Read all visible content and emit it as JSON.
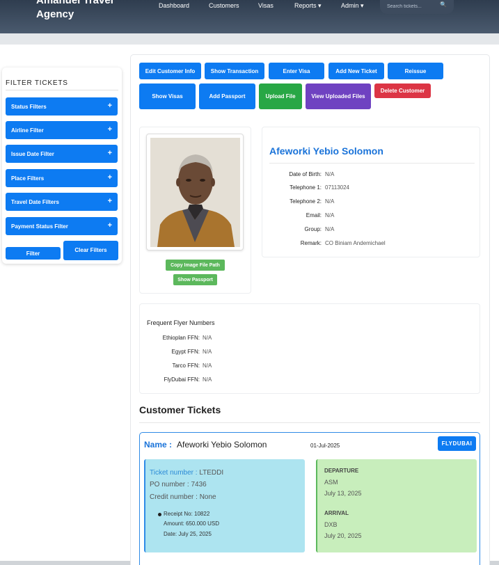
{
  "header": {
    "brand": "Amanuel Travel\nAgency",
    "nav": [
      "Dashboard",
      "Customers",
      "Visas",
      "Reports ▾",
      "Admin ▾"
    ],
    "search_placeholder": "Search tickets..."
  },
  "sidebar": {
    "title": "FILTER TICKETS",
    "filters": [
      "Status Filters",
      "Airline Filter",
      "Issue Date Filter",
      "Place Filters",
      "Travel Date Filters",
      "Payment Status Filter"
    ],
    "filter_button": "Filter",
    "clear_button": "Clear Filters"
  },
  "actions": {
    "edit": "Edit Customer Info",
    "show_transaction": "Show Transaction",
    "enter_visa": "Enter Visa",
    "add_ticket": "Add New Ticket",
    "reissue": "Reissue",
    "show_visas": "Show Visas",
    "add_passport": "Add Passport",
    "upload_file": "Upload File",
    "view_files": "View Uploaded Files",
    "delete_customer": "Delete Customer"
  },
  "photo": {
    "copy_path": "Copy Image File Path",
    "show_passport": "Show Passport"
  },
  "customer": {
    "name": "Afeworki Yebio Solomon",
    "fields": [
      {
        "label": "Date of Birth:",
        "value": "N/A"
      },
      {
        "label": "Telephone 1:",
        "value": "07113024"
      },
      {
        "label": "Telephone 2:",
        "value": "N/A"
      },
      {
        "label": "Email:",
        "value": "N/A"
      },
      {
        "label": "Group:",
        "value": "N/A"
      },
      {
        "label": "Remark:",
        "value": "CO Biniam Andemichael"
      }
    ]
  },
  "ffn": {
    "title": "Frequent Flyer Numbers",
    "rows": [
      {
        "label": "Ethioplan FFN:",
        "value": "N/A"
      },
      {
        "label": "Egypt FFN:",
        "value": "N/A"
      },
      {
        "label": "Tarco FFN:",
        "value": "N/A"
      },
      {
        "label": "FlyDubai FFN:",
        "value": "N/A"
      }
    ]
  },
  "tickets_section": {
    "title": "Customer Tickets"
  },
  "ticket": {
    "name_label": "Name :",
    "name": "Afeworki Yebio Solomon",
    "date": "01-Jul-2025",
    "airline": "FLYDUBAI",
    "ticket_number_label": "Ticket number :",
    "ticket_number": "LTEDDI",
    "po_label": "PO number :",
    "po_number": "7436",
    "credit_label": "Credit number :",
    "credit_number": "None",
    "receipt": {
      "no": "Receipt No: 10822",
      "amount": "Amount: 650.000 USD",
      "date": "Date: July 25, 2025"
    },
    "departure_label": "DEPARTURE",
    "departure_place": "ASM",
    "departure_date": "July 13, 2025",
    "arrival_label": "ARRIVAL",
    "arrival_place": "DXB",
    "arrival_date": "July 20, 2025"
  }
}
